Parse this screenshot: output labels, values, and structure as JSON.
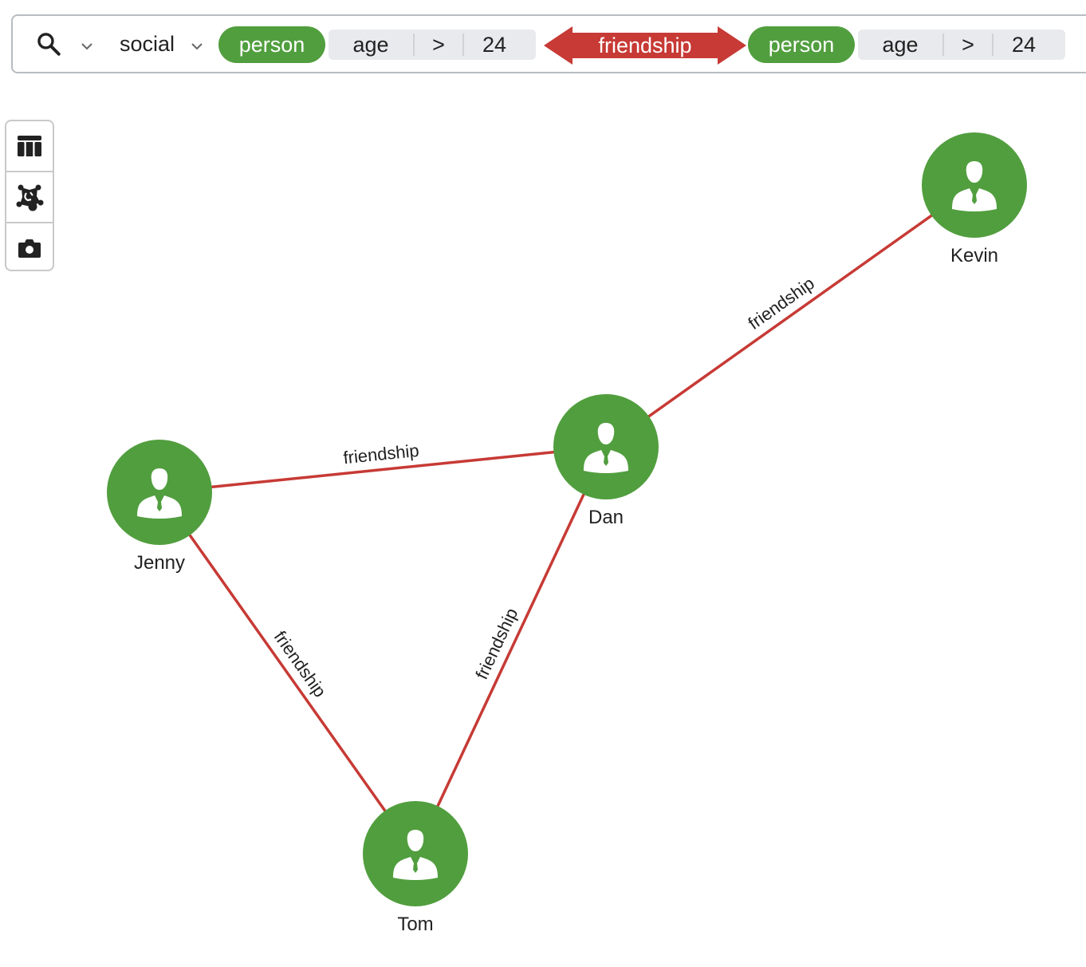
{
  "query": {
    "database": "social",
    "source_node": {
      "label": "person",
      "condition": {
        "property": "age",
        "operator": ">",
        "value": "24"
      }
    },
    "relationship": {
      "label": "friendship",
      "direction": "both"
    },
    "target_node": {
      "label": "person",
      "condition": {
        "property": "age",
        "operator": ">",
        "value": "24"
      }
    }
  },
  "toolbar": {
    "items": [
      {
        "name": "table-view",
        "icon": "table-icon"
      },
      {
        "name": "graph-view",
        "icon": "graph-network-icon"
      },
      {
        "name": "screenshot",
        "icon": "camera-icon"
      }
    ]
  },
  "colors": {
    "node": "#519e3e",
    "edge": "#c73a35",
    "condition_bg": "#e8eaed"
  },
  "graph": {
    "nodes": [
      {
        "id": "kevin",
        "label": "Kevin"
      },
      {
        "id": "dan",
        "label": "Dan"
      },
      {
        "id": "jenny",
        "label": "Jenny"
      },
      {
        "id": "tom",
        "label": "Tom"
      }
    ],
    "edges": [
      {
        "source": "dan",
        "target": "kevin",
        "label": "friendship"
      },
      {
        "source": "jenny",
        "target": "dan",
        "label": "friendship"
      },
      {
        "source": "jenny",
        "target": "tom",
        "label": "friendship"
      },
      {
        "source": "tom",
        "target": "dan",
        "label": "friendship"
      }
    ]
  }
}
